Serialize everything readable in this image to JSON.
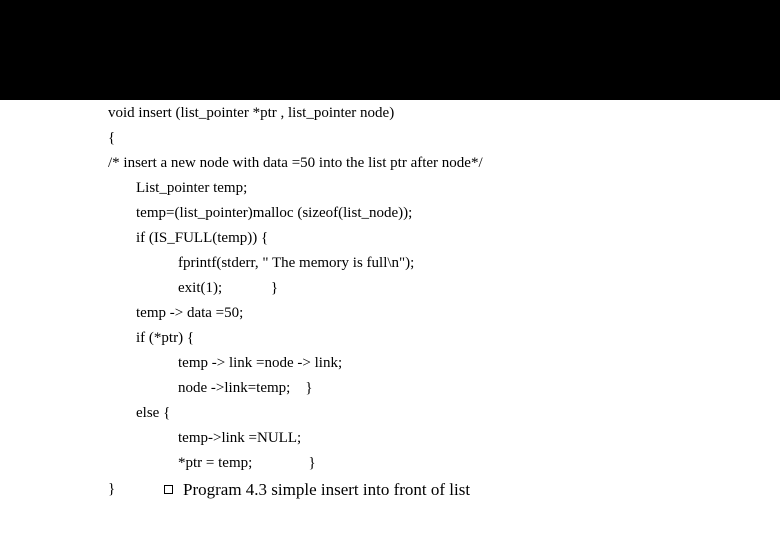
{
  "code": {
    "l1": "void insert (list_pointer *ptr , list_pointer node)",
    "l2": "{",
    "l3": "/* insert a new node with data =50 into the list ptr after node*/",
    "l4": "List_pointer temp;",
    "l5": "temp=(list_pointer)malloc (sizeof(list_node));",
    "l6": "if (IS_FULL(temp)) {",
    "l7": "fprintf(stderr, \" The memory is full\\n\");",
    "l8": "exit(1);             }",
    "l9": "temp -> data =50;",
    "l10": "if (*ptr) {",
    "l11": "temp -> link =node -> link;",
    "l12": "node ->link=temp;    }",
    "l13": "else {",
    "l14": "temp->link =NULL;",
    "l15": "*ptr = temp;               }",
    "l16": "}"
  },
  "caption": "Program 4.3 simple insert into front of list"
}
